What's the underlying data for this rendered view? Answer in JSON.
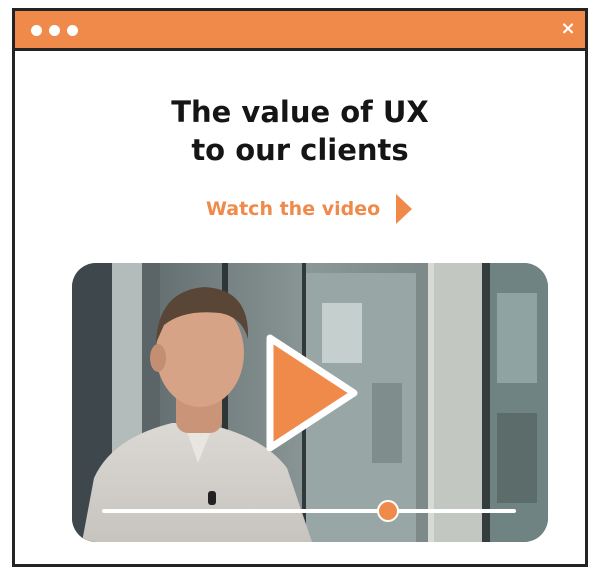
{
  "window": {
    "titlebar_color": "#EF8A4A",
    "close_label": "×"
  },
  "headline": {
    "line1": "The value of UX",
    "line2": "to our clients"
  },
  "cta": {
    "label": "Watch the video",
    "icon": "play-triangle-icon"
  },
  "video": {
    "play_icon": "play-icon",
    "progress": 0.69,
    "accent": "#EF8A4A"
  }
}
